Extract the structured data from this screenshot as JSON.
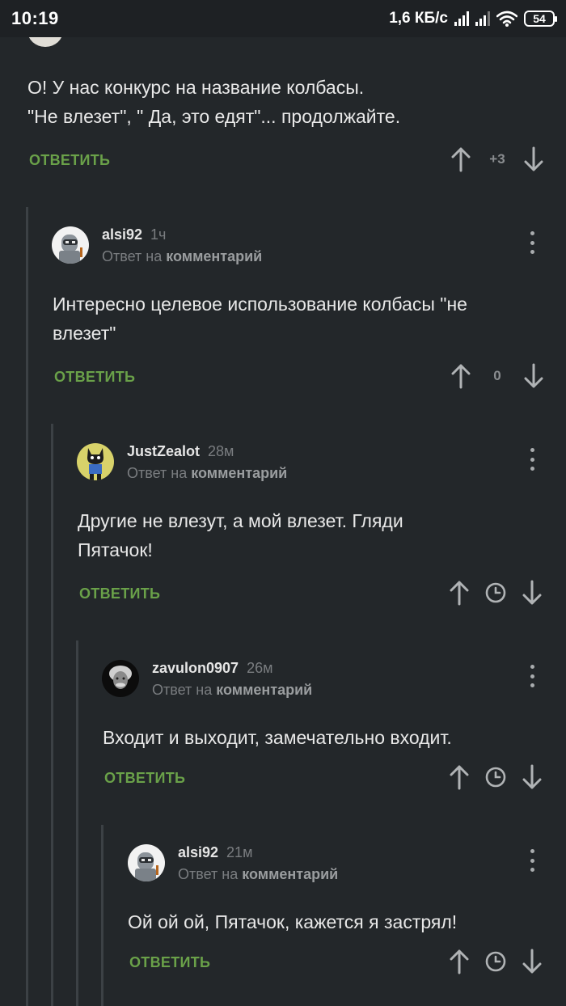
{
  "status_bar": {
    "time": "10:19",
    "network_speed": "1,6 КБ/с",
    "battery": "54"
  },
  "ui": {
    "reply_label": "ОТВЕТИТЬ",
    "reply_to_prefix": "Ответ на",
    "reply_to_target": "комментарий"
  },
  "comments": [
    {
      "text_line1": "О! У нас конкурс на название колбасы.",
      "text_line2": "\"Не влезет\", \" Да, это едят\"...  продолжайте.",
      "score": "+3"
    },
    {
      "username": "alsi92",
      "time": "1ч",
      "text_line1": "Интересно целевое использование колбасы \"не",
      "text_line2": "влезет\"",
      "score": "0"
    },
    {
      "username": "JustZealot",
      "time": "28м",
      "text_line1": "Другие не влезут, а мой влезет. Гляди",
      "text_line2": "Пятачок!"
    },
    {
      "username": "zavulon0907",
      "time": "26м",
      "text_line1": "Входит и выходит, замечательно входит."
    },
    {
      "username": "alsi92",
      "time": "21м",
      "text_line1": "Ой ой ой, Пятачок, кажется я застрял!"
    }
  ],
  "colors": {
    "background": "#23272a",
    "reply_green": "#6aa149",
    "thread_line": "#3c4145"
  }
}
